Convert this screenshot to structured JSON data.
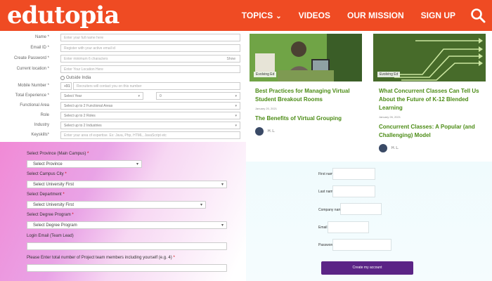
{
  "header": {
    "logo": "edutopia",
    "nav": [
      "TOPICS",
      "VIDEOS",
      "OUR MISSION",
      "SIGN UP"
    ],
    "colors": {
      "brand": "#ef4b23"
    }
  },
  "profile_form": {
    "rows": [
      {
        "label": "Name *",
        "value": "Enter your full name here"
      },
      {
        "label": "Email ID *",
        "value": "Register with your active email id"
      },
      {
        "label": "Create Password *",
        "value": "Enter minimum 6 characters",
        "extra": "Show"
      },
      {
        "label": "Current location *",
        "value": "Enter Your Location Here"
      },
      {
        "label": "",
        "value": "Outside India"
      },
      {
        "label": "Mobile Number *",
        "value": "Recruiters will contact you on this number",
        "prefix": "+91"
      },
      {
        "label": "Total Experience *",
        "value": "Select Year",
        "value2": "0"
      },
      {
        "label": "Functional Area",
        "value": "Select up to 2 Functional Areas"
      },
      {
        "label": "Role",
        "value": "Select up to 2 Roles"
      },
      {
        "label": "Industry",
        "value": "Select up to 2 Industries"
      },
      {
        "label": "Keyskills*",
        "value": "Enter your area of expertise. Ex: Java, Php, HTML, JavaScript etc"
      }
    ]
  },
  "articles": [
    {
      "tag": "Evolving Ed",
      "title": "Best Practices for Managing Virtual Student Breakout Rooms",
      "date": "January 20, 2021",
      "subtitle": "The Benefits of Virtual Grouping",
      "author": "H. L."
    },
    {
      "tag": "Evolving Ed",
      "title": "What Concurrent Classes Can Tell Us About the Future of K-12 Blended Learning",
      "date": "January 26, 2021",
      "subtitle": "Concurrent Classes: A Popular (and Challenging) Model",
      "author": "H. L."
    }
  ],
  "campus_form": {
    "province_label": "Select Province (Main Campus)",
    "province_value": "Select Province",
    "city_label": "Select Campus City",
    "city_value": "Select University First",
    "dept_label": "Select Department",
    "dept_value": "Select University First",
    "program_label": "Select Degree Program",
    "program_value": "Select Degree Program",
    "email_label": "Login Email (Team Lead)",
    "members_label": "Please Enter total number of Project team members including yourself (e.g. 4)",
    "req": "*"
  },
  "signup_form": {
    "fields": [
      "First name",
      "Last name",
      "Company name",
      "Email",
      "Password"
    ],
    "button": "Create my account",
    "button_color": "#5b2486"
  }
}
